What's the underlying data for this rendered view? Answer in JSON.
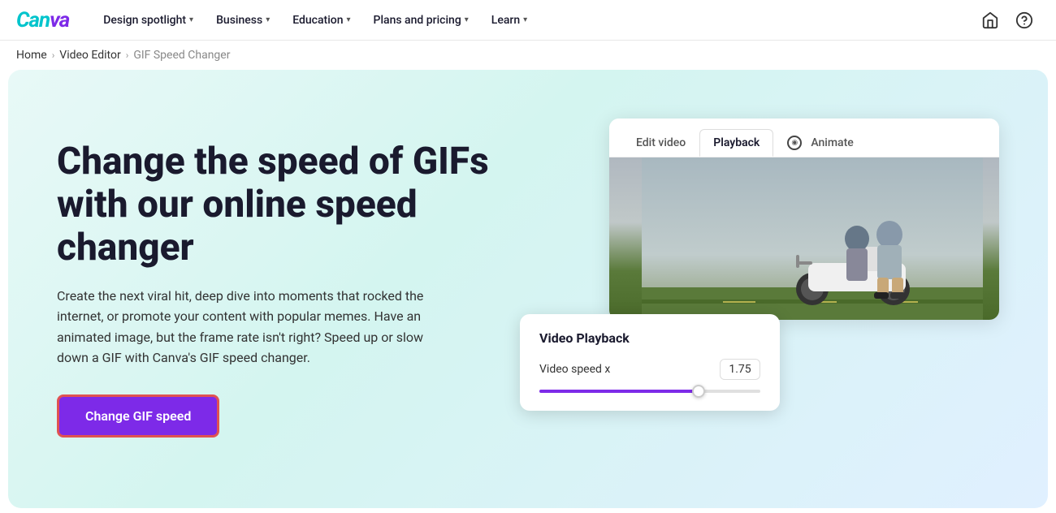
{
  "nav": {
    "logo": "Canva",
    "links": [
      {
        "id": "design-spotlight",
        "label": "Design spotlight",
        "hasDropdown": true
      },
      {
        "id": "business",
        "label": "Business",
        "hasDropdown": true
      },
      {
        "id": "education",
        "label": "Education",
        "hasDropdown": true
      },
      {
        "id": "plans-pricing",
        "label": "Plans and pricing",
        "hasDropdown": true
      },
      {
        "id": "learn",
        "label": "Learn",
        "hasDropdown": true
      }
    ],
    "icons": [
      {
        "id": "home",
        "symbol": "⌂",
        "label": "Home"
      },
      {
        "id": "help",
        "symbol": "?",
        "label": "Help"
      }
    ]
  },
  "breadcrumb": {
    "items": [
      {
        "label": "Home",
        "href": "#"
      },
      {
        "label": "Video Editor",
        "href": "#"
      },
      {
        "label": "GIF Speed Changer",
        "current": true
      }
    ]
  },
  "hero": {
    "title": "Change the speed of GIFs with our online speed changer",
    "description": "Create the next viral hit, deep dive into moments that rocked the internet, or promote your content with popular memes. Have an animated image, but the frame rate isn't right? Speed up or slow down a GIF with Canva's GIF speed changer.",
    "cta_label": "Change GIF speed"
  },
  "editor": {
    "tabs": [
      {
        "id": "edit-video",
        "label": "Edit video",
        "active": false
      },
      {
        "id": "playback",
        "label": "Playback",
        "active": true
      },
      {
        "id": "animate",
        "label": "Animate",
        "active": false,
        "hasIcon": true
      }
    ],
    "playback": {
      "title": "Video Playback",
      "speed_label": "Video speed x",
      "speed_value": "1.75",
      "slider_percent": 70
    }
  }
}
